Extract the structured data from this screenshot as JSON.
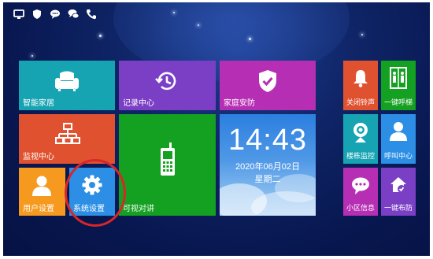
{
  "status_bar": {
    "icons": [
      "monitor-icon",
      "shield-icon",
      "message-icon",
      "chat-icon",
      "phone-icon"
    ]
  },
  "tiles": {
    "smart_home": "智能家居",
    "records": "记录中心",
    "security": "家庭安防",
    "monitor": "监视中心",
    "intercom": "可视对讲",
    "user_settings": "用户设置",
    "system_settings": "系统设置",
    "mute_ring": "关闭铃声",
    "one_key_call": "一键呼梯",
    "building_monitor": "楼栋监控",
    "call_center": "呼叫中心",
    "community_info": "小区信息",
    "one_key_arm": "一键布防"
  },
  "clock": {
    "time": "14:43",
    "date": "2020年06月02日",
    "weekday": "星期二"
  },
  "colors": {
    "smart_home": "#16a3b2",
    "records": "#7b3fc6",
    "security": "#b52eb3",
    "monitor": "#e0522f",
    "intercom": "#14a020",
    "user_settings": "#f59a1e",
    "system_settings": "#2c8fe5",
    "highlight_ring": "#d8262b"
  }
}
